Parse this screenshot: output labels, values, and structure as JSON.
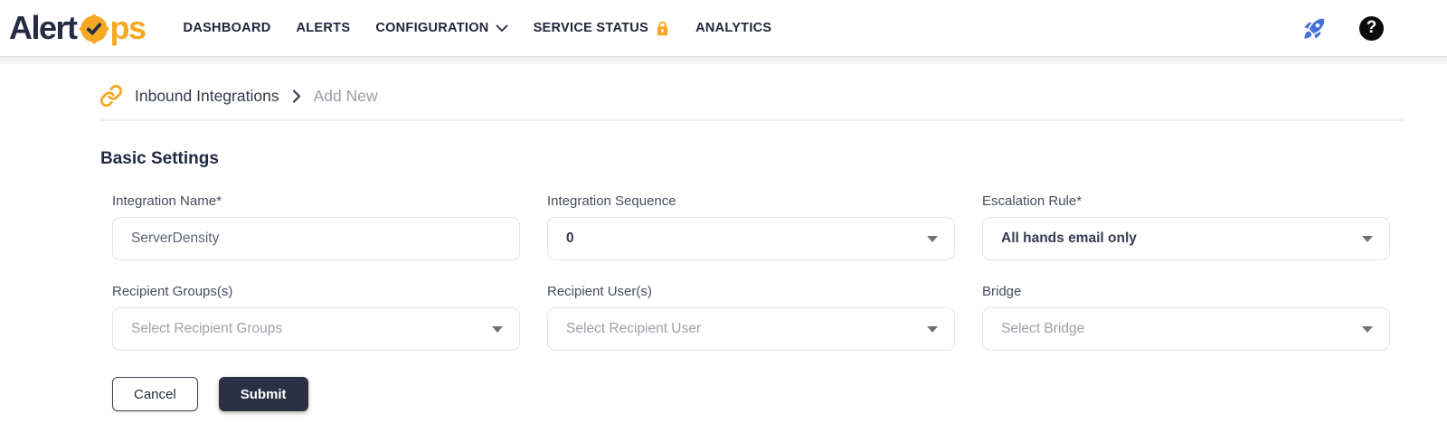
{
  "colors": {
    "accent_orange": "#F7A823",
    "navy": "#252B42",
    "rocket_blue": "#4470D6",
    "submit_bg": "#2B3044"
  },
  "header": {
    "logo": {
      "text_dark": "Alert",
      "text_orange": "ps"
    },
    "nav": [
      {
        "label": "DASHBOARD"
      },
      {
        "label": "ALERTS"
      },
      {
        "label": "CONFIGURATION"
      },
      {
        "label": "SERVICE STATUS"
      },
      {
        "label": "ANALYTICS"
      }
    ],
    "help_glyph": "?"
  },
  "breadcrumb": {
    "section": "Inbound Integrations",
    "current": "Add New"
  },
  "page": {
    "heading": "Basic Settings"
  },
  "form": {
    "fields": [
      {
        "label": "Integration Name*",
        "value": "ServerDensity"
      },
      {
        "label": "Integration Sequence",
        "value": "0"
      },
      {
        "label": "Escalation Rule*",
        "value": "All hands email only"
      },
      {
        "label": "Recipient Groups(s)",
        "placeholder": "Select Recipient Groups"
      },
      {
        "label": "Recipient User(s)",
        "placeholder": "Select Recipient User"
      },
      {
        "label": "Bridge",
        "placeholder": "Select Bridge"
      }
    ],
    "buttons": {
      "cancel_label": "Cancel",
      "submit_label": "Submit"
    }
  }
}
